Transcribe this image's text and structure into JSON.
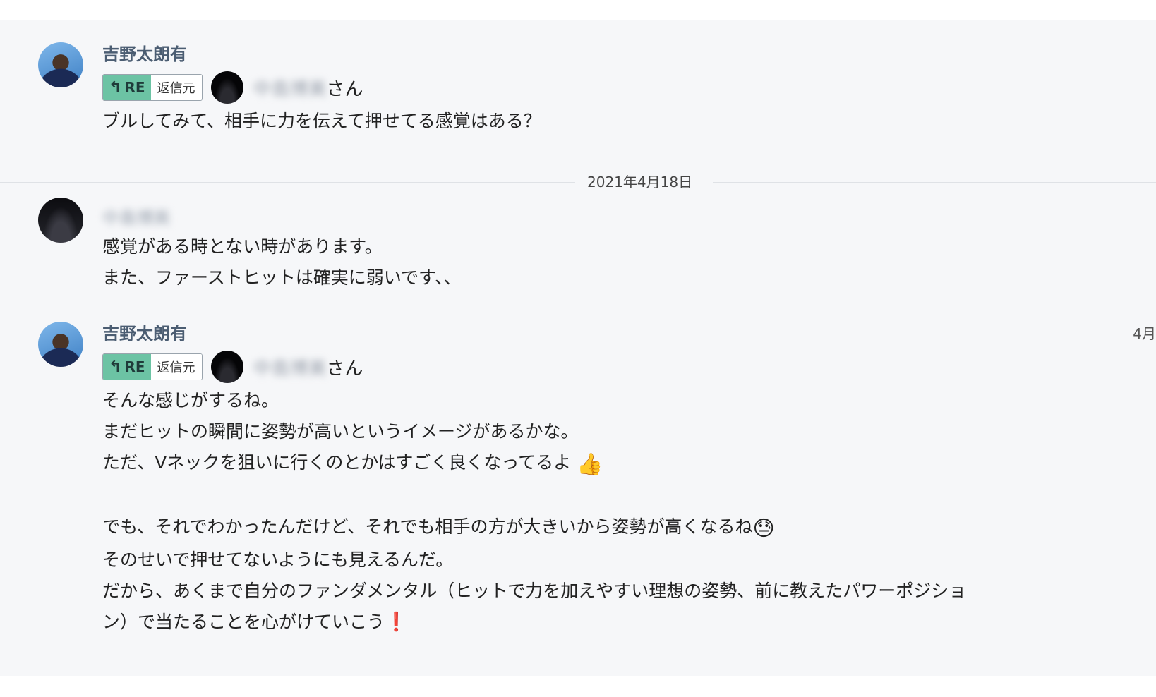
{
  "messages": [
    {
      "sender": "吉野太朗有",
      "reply_badge": {
        "tag": "RE",
        "label": "返信元"
      },
      "mention": {
        "name": "中島博美",
        "suffix": "さん"
      },
      "lines": [
        "ブルしてみて、相手に力を伝えて押せてる感覚はある？"
      ]
    },
    {
      "sender": "中島博美",
      "lines": [
        "感覚がある時とない時があります。",
        "また、ファーストヒットは確実に弱いです、、"
      ]
    },
    {
      "sender": "吉野太朗有",
      "timestamp": "4月",
      "reply_badge": {
        "tag": "RE",
        "label": "返信元"
      },
      "mention": {
        "name": "中島博美",
        "suffix": "さん"
      },
      "lines": [
        "そんな感じがするね。",
        "まだヒットの瞬間に姿勢が高いというイメージがあるかな。",
        "ただ、Vネックを狙いに行くのとかはすごく良くなってるよ",
        "",
        "でも、それでわかったんだけど、それでも相手の方が大きいから姿勢が高くなるね",
        "そのせいで押せてないようにも見えるんだ。",
        "だから、あくまで自分のファンダメンタル（ヒットで力を加えやすい理想の姿勢、前に教えたパワーポジショ",
        "ン）で当たることを心がけていこう"
      ],
      "emojis": {
        "thumbs_up": "👍",
        "sweat_smile": "😓",
        "exclamation": "❗"
      }
    }
  ],
  "date_divider": "2021年4月18日",
  "colors": {
    "re_badge_bg": "#6cc3a4",
    "sender_name": "#4b5d72",
    "background": "#f6f7f9"
  }
}
